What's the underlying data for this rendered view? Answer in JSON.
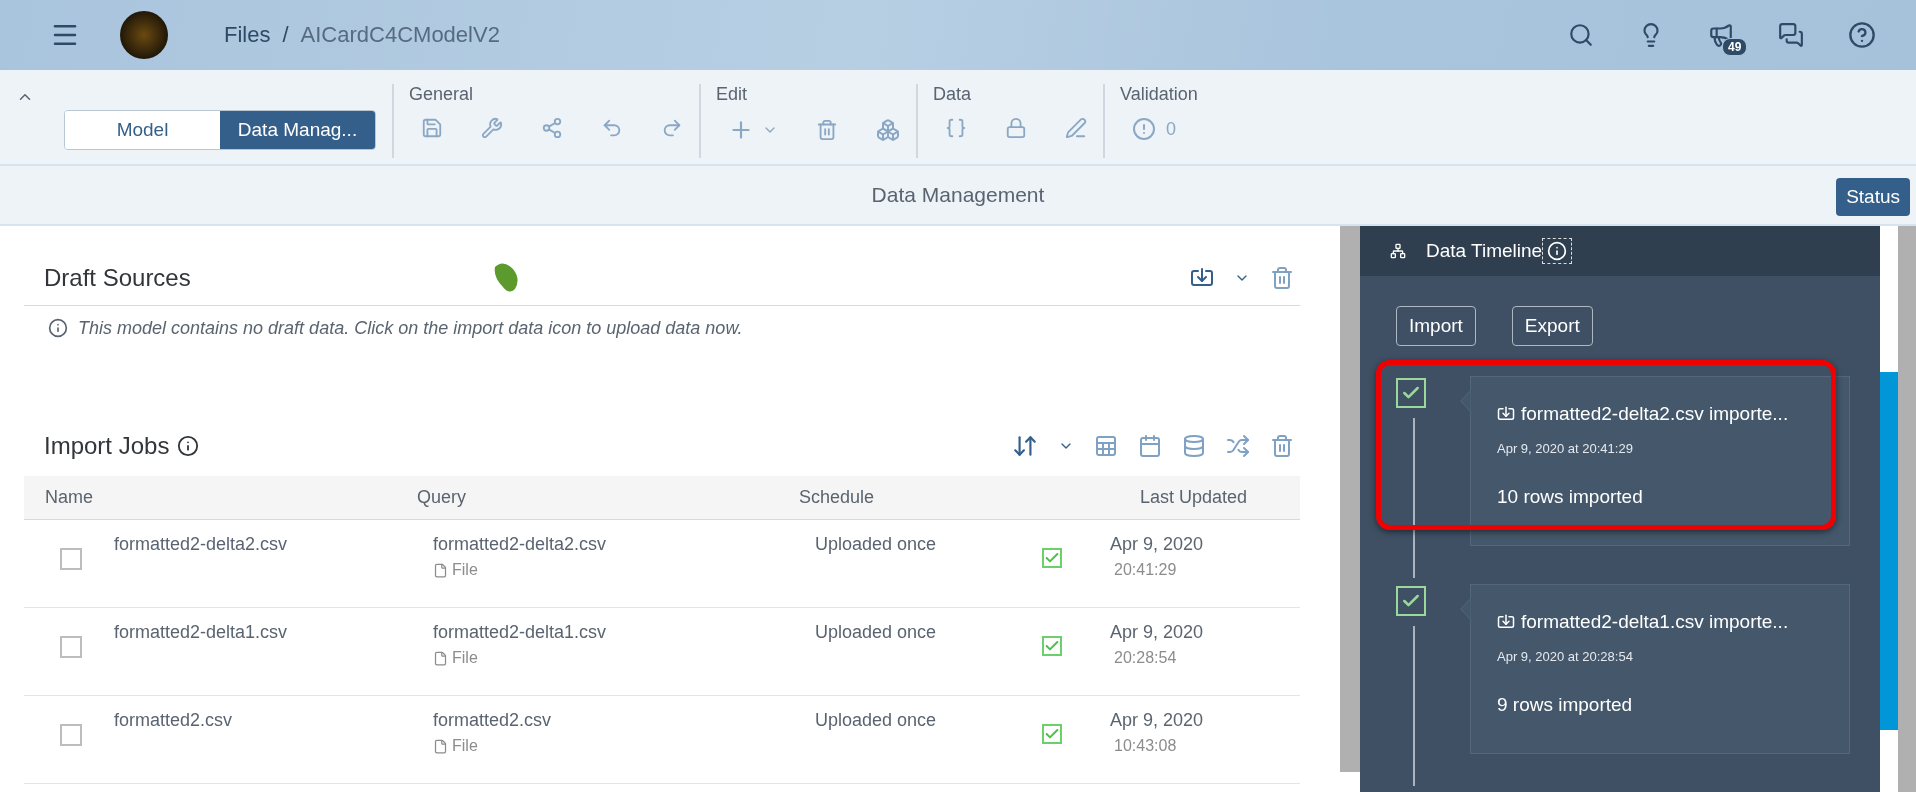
{
  "header": {
    "breadcrumb": [
      "Files",
      "AICardC4CModelV2"
    ],
    "separator": "/",
    "notification_count": "49"
  },
  "toolbar": {
    "collapsed": false,
    "views": [
      {
        "label": "Model",
        "selected": false
      },
      {
        "label": "Data Manag...",
        "selected": true
      }
    ],
    "groups": [
      {
        "title": "General"
      },
      {
        "title": "Edit"
      },
      {
        "title": "Data"
      },
      {
        "title": "Validation",
        "count": "0"
      }
    ]
  },
  "title_bar": {
    "title": "Data Management",
    "button": "Status"
  },
  "draft_sources": {
    "title": "Draft Sources",
    "info": "This model contains no draft data. Click on the import data icon to upload data now."
  },
  "import_jobs": {
    "title": "Import Jobs",
    "columns": [
      "Name",
      "Query",
      "Schedule",
      "Last Updated"
    ],
    "rows": [
      {
        "selected": false,
        "name": "formatted2-delta2.csv",
        "query": "formatted2-delta2.csv",
        "query_type": "File",
        "schedule": "Uploaded once",
        "succeeded": true,
        "date": "Apr 9, 2020",
        "time": "20:41:29"
      },
      {
        "selected": false,
        "name": "formatted2-delta1.csv",
        "query": "formatted2-delta1.csv",
        "query_type": "File",
        "schedule": "Uploaded once",
        "succeeded": true,
        "date": "Apr 9, 2020",
        "time": "20:28:54"
      },
      {
        "selected": false,
        "name": "formatted2.csv",
        "query": "formatted2.csv",
        "query_type": "File",
        "schedule": "Uploaded once",
        "succeeded": true,
        "date": "Apr 9, 2020",
        "time": "10:43:08"
      }
    ]
  },
  "timeline": {
    "title": "Data Timeline",
    "buttons": [
      "Import",
      "Export"
    ],
    "entries": [
      {
        "done": true,
        "highlighted": true,
        "title": "formatted2-delta2.csv importe...",
        "timestamp": "Apr 9, 2020 at 20:41:29",
        "summary": "10 rows imported"
      },
      {
        "done": true,
        "highlighted": false,
        "title": "formatted2-delta1.csv importe...",
        "timestamp": "Apr 9, 2020 at 20:28:54",
        "summary": "9 rows imported"
      }
    ]
  }
}
